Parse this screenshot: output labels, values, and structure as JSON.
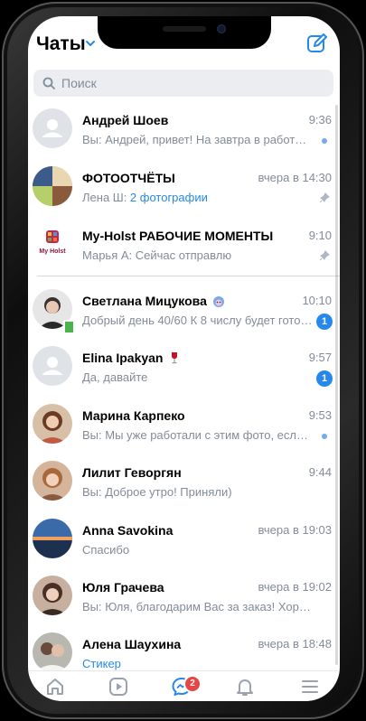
{
  "header": {
    "title": "Чаты"
  },
  "search": {
    "placeholder": "Поиск"
  },
  "chats": [
    {
      "name": "Андрей Шоев",
      "time": "9:36",
      "preview": "Вы: Андрей, привет! На завтра в работе Б…",
      "indicator": "unread-dot"
    },
    {
      "name": "ФОТООТЧЁТЫ",
      "time": "вчера в 14:30",
      "preview_prefix": "Лена Ш: ",
      "preview_accent": "2 фотографии",
      "indicator": "pinned"
    },
    {
      "name": "My-Holst РАБОЧИЕ МОМЕНТЫ",
      "time": "9:10",
      "preview": "Марья А: Сейчас отправлю",
      "indicator": "pinned"
    },
    {
      "name": "Светлана Мицукова",
      "time": "10:10",
      "preview": "Добрый день 40/60  К 8 числу будет гото…",
      "badge": "1",
      "emoji": "hedgehog-emoji"
    },
    {
      "name": "Elina Ipakyan",
      "time": "9:57",
      "preview": "Да, давайте",
      "badge": "1",
      "emoji": "wine-glass-emoji"
    },
    {
      "name": "Марина Карпеко",
      "time": "9:53",
      "preview": "Вы: Мы уже работали с этим фото, если м…",
      "indicator": "unread-dot"
    },
    {
      "name": "Лилит Геворгян",
      "time": "9:44",
      "preview": "Вы: Доброе утро! Приняли)"
    },
    {
      "name": "Anna Savokina",
      "time": "вчера в 19:03",
      "preview": "Спасибо"
    },
    {
      "name": "Юля Грачева",
      "time": "вчера в 19:02",
      "preview": "Вы: Юля, благодарим Вас за заказ! Хорошег…"
    },
    {
      "name": "Алена Шаухина",
      "time": "вчера в 18:48",
      "preview": "Стикер"
    }
  ],
  "tabbar": {
    "messages_badge": "2"
  },
  "colors": {
    "accent": "#2688eb",
    "secondary_text": "#818c99",
    "badge": "#2688eb",
    "alert": "#e64646"
  }
}
